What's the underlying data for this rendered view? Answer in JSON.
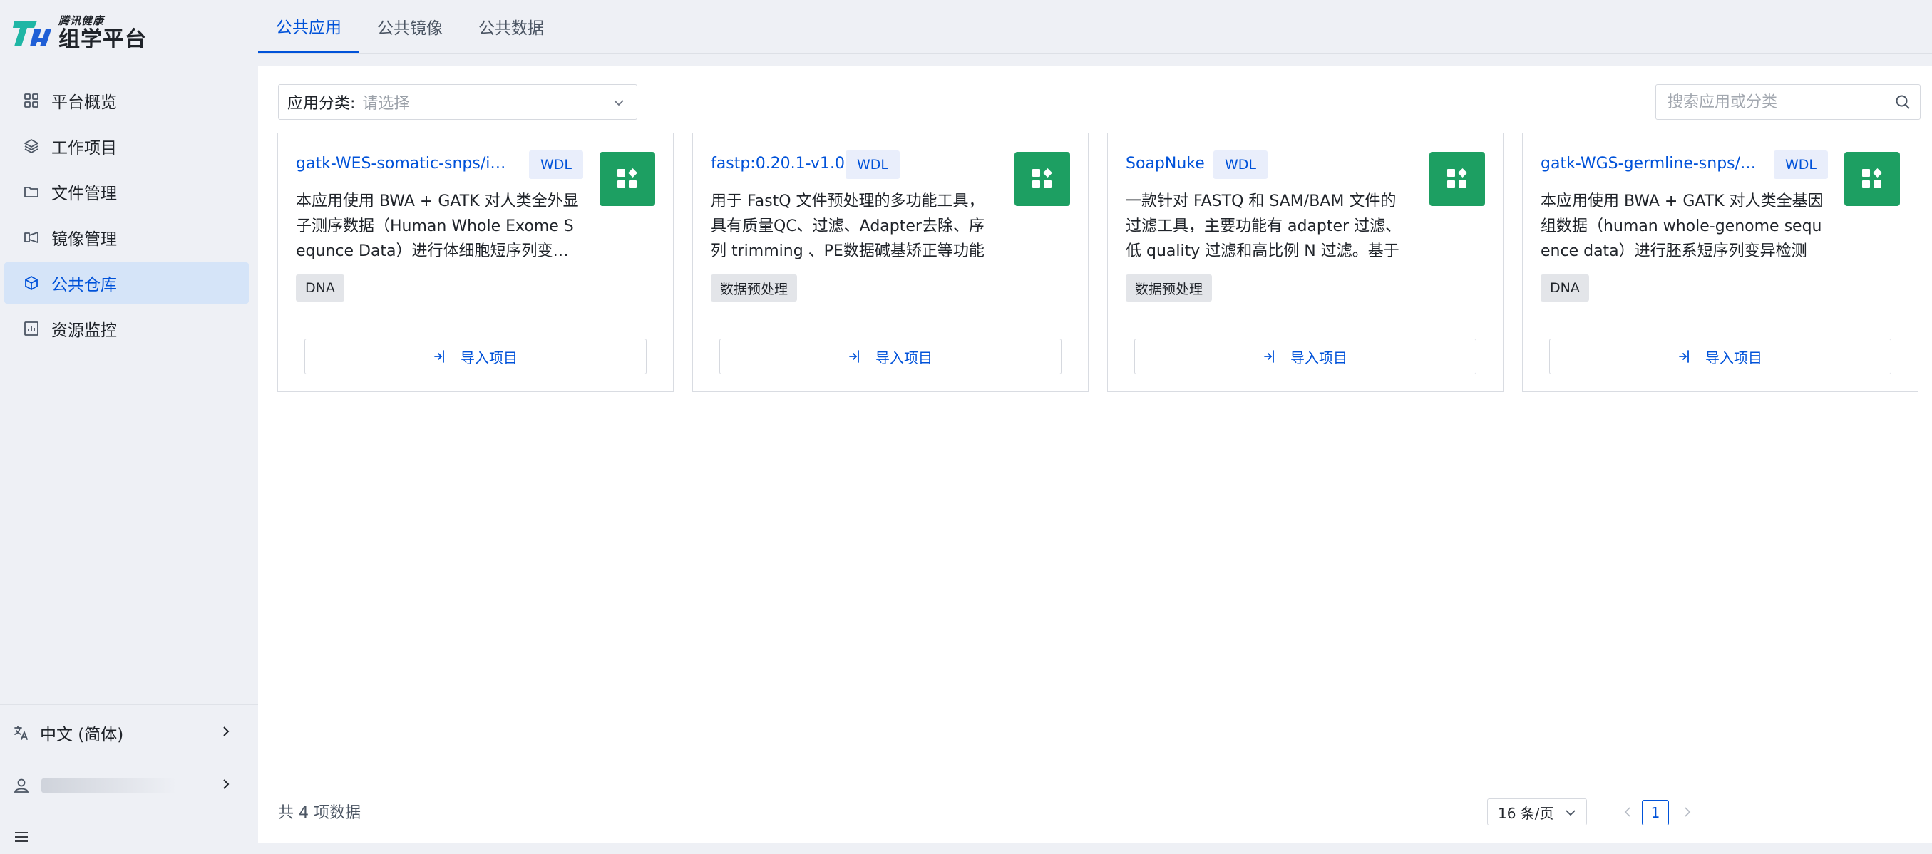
{
  "brand": {
    "small": "腾讯健康",
    "name": "组学平台",
    "colors": {
      "teal": "#1fb6a5",
      "blue": "#1f5fd6"
    }
  },
  "sidebar": {
    "items": [
      {
        "label": "平台概览",
        "icon": "grid-icon",
        "active": false
      },
      {
        "label": "工作项目",
        "icon": "layers-icon",
        "active": false
      },
      {
        "label": "文件管理",
        "icon": "folder-icon",
        "active": false
      },
      {
        "label": "镜像管理",
        "icon": "image-icon",
        "active": false
      },
      {
        "label": "公共仓库",
        "icon": "cube-icon",
        "active": true
      },
      {
        "label": "资源监控",
        "icon": "chart-icon",
        "active": false
      }
    ],
    "language": "中文 (简体)"
  },
  "tabs": [
    {
      "label": "公共应用",
      "active": true
    },
    {
      "label": "公共镜像",
      "active": false
    },
    {
      "label": "公共数据",
      "active": false
    }
  ],
  "filter": {
    "label": "应用分类:",
    "placeholder": "请选择"
  },
  "search": {
    "placeholder": "搜索应用或分类"
  },
  "cards": [
    {
      "title": "gatk-WES-somatic-snps/indels",
      "badge": "WDL",
      "description": "本应用使用 BWA + GATK 对人类全外显子测序数据（Human Whole Exome Sequnce Data）进行体细胞短序列变异检测",
      "tag": "DNA",
      "button": "导入项目"
    },
    {
      "title": "fastp:0.20.1-v1.0",
      "badge": "WDL",
      "description": "用于 FastQ 文件预处理的多功能工具，具有质量QC、过滤、Adapter去除、序列 trimming 、PE数据碱基矫正等功能",
      "tag": "数据预处理",
      "button": "导入项目"
    },
    {
      "title": "SoapNuke",
      "badge": "WDL",
      "description": "一款针对 FASTQ 和 SAM/BAM 文件的过滤工具，主要功能有 adapter 过滤、低 quality 过滤和高比例 N 过滤。基于",
      "tag": "数据预处理",
      "button": "导入项目"
    },
    {
      "title": "gatk-WGS-germline-snps/indels",
      "badge": "WDL",
      "description": "本应用使用 BWA + GATK 对人类全基因组数据（human whole-genome sequence data）进行胚系短序列变异检测",
      "tag": "DNA",
      "button": "导入项目"
    }
  ],
  "footer": {
    "total": "共 4 项数据",
    "page_size": "16 条/页",
    "current_page": "1"
  },
  "colors": {
    "primary": "#0052d9",
    "app_icon": "#1d9f62",
    "active_nav_bg": "#d5e4f8"
  }
}
